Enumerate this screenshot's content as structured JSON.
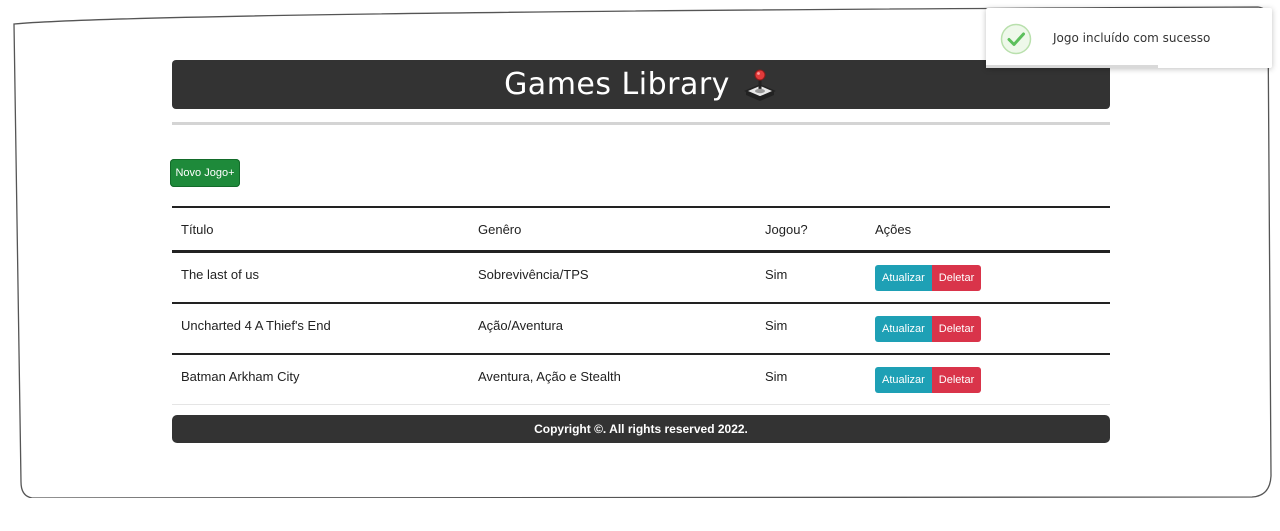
{
  "header": {
    "title": "Games Library"
  },
  "actions": {
    "new_game_label": "Novo Jogo+"
  },
  "table": {
    "columns": [
      "Título",
      "Genêro",
      "Jogou?",
      "Ações"
    ],
    "rows": [
      {
        "title": "The last of us",
        "genre": "Sobrevivência/TPS",
        "played": "Sim"
      },
      {
        "title": "Uncharted 4 A Thief's End",
        "genre": "Ação/Aventura",
        "played": "Sim"
      },
      {
        "title": "Batman Arkham City",
        "genre": "Aventura, Ação e Stealth",
        "played": "Sim"
      }
    ],
    "update_label": "Atualizar",
    "delete_label": "Deletar"
  },
  "footer": {
    "text": "Copyright ©. All rights reserved 2022."
  },
  "toast": {
    "message": "Jogo incluído com sucesso",
    "progress": 0.6,
    "icon": "check-circle-icon"
  },
  "colors": {
    "header_bg": "#333333",
    "new_button": "#1e8a3a",
    "update_button": "#1ea0b5",
    "delete_button": "#d9344a",
    "success": "#5cbf5c"
  }
}
